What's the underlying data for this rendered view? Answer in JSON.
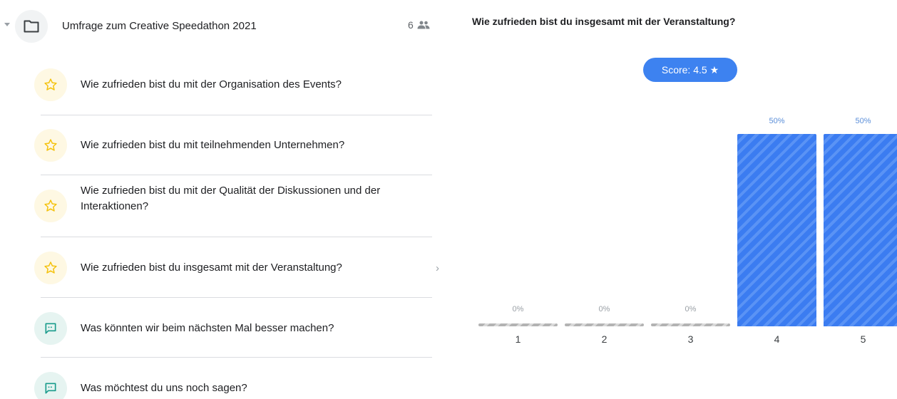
{
  "folder": {
    "title": "Umfrage zum Creative Speedathon 2021",
    "participant_count": "6"
  },
  "questions": [
    {
      "label": "Wie zufrieden bist du mit der Organisation des Events?",
      "icon": "star-icon"
    },
    {
      "label": "Wie zufrieden bist du mit teilnehmenden Unternehmen?",
      "icon": "star-icon"
    },
    {
      "label": "Wie zufrieden bist du mit der Qualität der Diskussionen und der Interaktionen?",
      "icon": "star-icon"
    },
    {
      "label": "Wie zufrieden bist du insgesamt mit der Veranstaltung?",
      "icon": "star-icon"
    },
    {
      "label": "Was könnten wir beim nächsten Mal besser machen?",
      "icon": "comment-icon"
    },
    {
      "label": "Was möchtest du uns noch sagen?",
      "icon": "comment-icon"
    }
  ],
  "result": {
    "title": "Wie zufrieden bist du insgesamt mit der Veranstaltung?",
    "score_label": "Score: 4.5 ★"
  },
  "colors": {
    "accent": "#3d82f0",
    "star": "#f4c20d",
    "comment": "#1a9c8c"
  },
  "chart_data": {
    "type": "bar",
    "categories": [
      "1",
      "2",
      "3",
      "4",
      "5"
    ],
    "values": [
      0,
      0,
      0,
      50,
      50
    ],
    "value_labels": [
      "0%",
      "0%",
      "0%",
      "50%",
      "50%"
    ],
    "ylim": [
      0,
      50
    ]
  }
}
